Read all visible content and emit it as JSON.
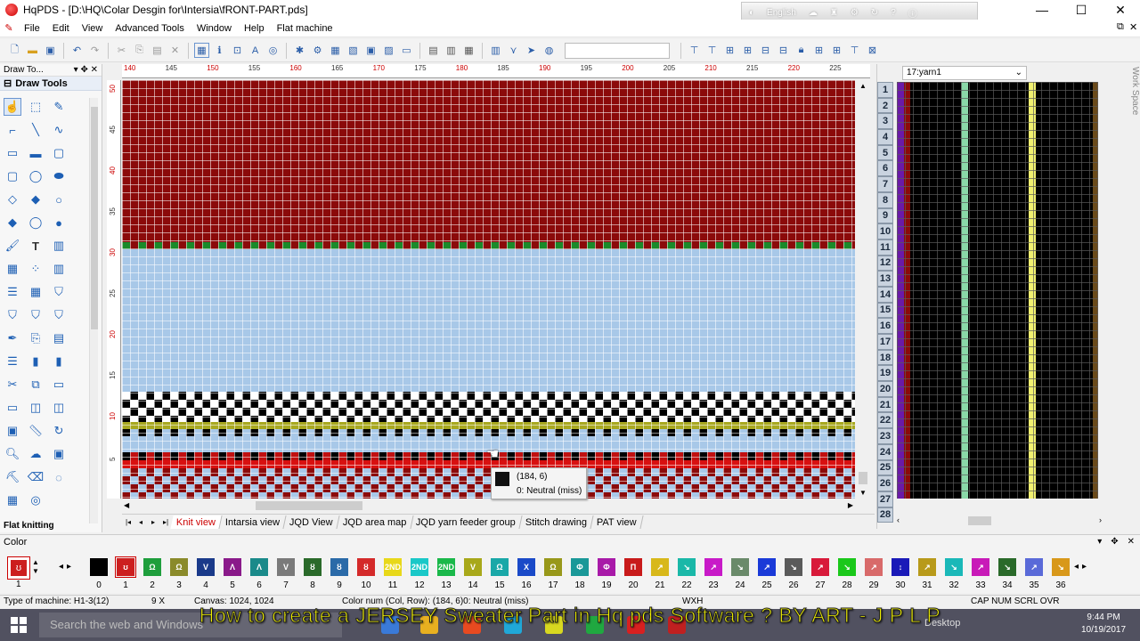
{
  "window": {
    "title": "HqPDS - [D:\\HQ\\Colar Desgin for\\Intersia\\fRONT-PART.pds]",
    "language": "English",
    "minimize": "—",
    "maximize": "☐",
    "close": "✕"
  },
  "menu": [
    "File",
    "Edit",
    "View",
    "Advanced Tools",
    "Window",
    "Help",
    "Flat machine"
  ],
  "left_panel": {
    "dock_title": "Draw To...",
    "section": "Draw Tools",
    "footer": "Flat knitting"
  },
  "rulers": {
    "top": [
      "140",
      "145",
      "150",
      "155",
      "160",
      "165",
      "170",
      "175",
      "180",
      "185",
      "190",
      "195",
      "200",
      "205",
      "210",
      "215",
      "220",
      "225"
    ],
    "left": [
      "50",
      "45",
      "40",
      "35",
      "30",
      "25",
      "20",
      "15",
      "10",
      "5"
    ]
  },
  "tooltip": {
    "coord": "(184, 6)",
    "info": "0: Neutral (miss)"
  },
  "tabs": [
    {
      "label": "Knit view",
      "active": true
    },
    {
      "label": "Intarsia view"
    },
    {
      "label": "JQD View"
    },
    {
      "label": "JQD area map"
    },
    {
      "label": "JQD yarn feeder group"
    },
    {
      "label": "Stitch drawing"
    },
    {
      "label": "PAT view"
    }
  ],
  "right_panel": {
    "selector": "17:yarn1",
    "rows": [
      "1",
      "2",
      "3",
      "4",
      "5",
      "6",
      "7",
      "8",
      "9",
      "10",
      "11",
      "12",
      "13",
      "14",
      "15",
      "16",
      "17",
      "18",
      "19",
      "20",
      "21",
      "22",
      "23",
      "24",
      "25",
      "26",
      "27",
      "28"
    ],
    "side_tab": "Work Space"
  },
  "color_panel": {
    "title": "Color",
    "current_index": "1",
    "swatches": [
      {
        "num": "0",
        "color": "#000000",
        "label": ""
      },
      {
        "num": "1",
        "color": "#cc1f1f",
        "label": "ʊ"
      },
      {
        "num": "2",
        "color": "#1e9e3c",
        "label": "Ω"
      },
      {
        "num": "3",
        "color": "#8a8a2a",
        "label": "Ω"
      },
      {
        "num": "4",
        "color": "#1a3a8a",
        "label": "V"
      },
      {
        "num": "5",
        "color": "#8a1a8a",
        "label": "Λ"
      },
      {
        "num": "6",
        "color": "#1a8a8a",
        "label": "Λ"
      },
      {
        "num": "7",
        "color": "#7a7a7a",
        "label": "V"
      },
      {
        "num": "8",
        "color": "#2a6a2a",
        "label": "ȣ"
      },
      {
        "num": "9",
        "color": "#2a6aa8",
        "label": "ȣ"
      },
      {
        "num": "10",
        "color": "#d42a2a",
        "label": "ȣ"
      },
      {
        "num": "11",
        "color": "#e8d81a",
        "label": "2ND"
      },
      {
        "num": "12",
        "color": "#1ac8c8",
        "label": "2ND"
      },
      {
        "num": "13",
        "color": "#1ab84a",
        "label": "2ND"
      },
      {
        "num": "14",
        "color": "#a8a81a",
        "label": "V"
      },
      {
        "num": "15",
        "color": "#1aa8a8",
        "label": "Ω"
      },
      {
        "num": "16",
        "color": "#1a4ac8",
        "label": "X"
      },
      {
        "num": "17",
        "color": "#98981a",
        "label": "Ω"
      },
      {
        "num": "18",
        "color": "#1a9898",
        "label": "Φ"
      },
      {
        "num": "19",
        "color": "#a81aa8",
        "label": "Φ"
      },
      {
        "num": "20",
        "color": "#c81a1a",
        "label": "Π"
      },
      {
        "num": "21",
        "color": "#d8b81a",
        "label": "↗"
      },
      {
        "num": "22",
        "color": "#1ab8a8",
        "label": "↘"
      },
      {
        "num": "23",
        "color": "#c81ac8",
        "label": "↗"
      },
      {
        "num": "24",
        "color": "#6a8a6a",
        "label": "↘"
      },
      {
        "num": "25",
        "color": "#1a3ad8",
        "label": "↗"
      },
      {
        "num": "26",
        "color": "#5a5a5a",
        "label": "↘"
      },
      {
        "num": "27",
        "color": "#d81a3a",
        "label": "↗"
      },
      {
        "num": "28",
        "color": "#1ac81a",
        "label": "↘"
      },
      {
        "num": "29",
        "color": "#d86a6a",
        "label": "↗"
      },
      {
        "num": "30",
        "color": "#1a1ab8",
        "label": "↕"
      },
      {
        "num": "31",
        "color": "#b89a1a",
        "label": "↗"
      },
      {
        "num": "32",
        "color": "#1ab8b8",
        "label": "↘"
      },
      {
        "num": "33",
        "color": "#c81ab8",
        "label": "↗"
      },
      {
        "num": "34",
        "color": "#2a6a2a",
        "label": "↘"
      },
      {
        "num": "35",
        "color": "#5a6ad8",
        "label": "↗"
      },
      {
        "num": "36",
        "color": "#d8981a",
        "label": "↘"
      }
    ]
  },
  "status": {
    "machine": "Type of machine: H1-3(12)",
    "zoom": "9 X",
    "canvas": "Canvas: 1024, 1024",
    "color_num": "Color num  (Col, Row): (184, 6)0: Neutral (miss)",
    "wxh": "WXH",
    "caps": "CAP  NUM  SCRL  OVR"
  },
  "caption": "How to create a JERSEY Sweater Part in Hq pds Software ? BY ART  - J P L P",
  "taskbar": {
    "search": "Search the web and Windows",
    "desktop": "Desktop",
    "time": "9:44 PM",
    "date": "10/19/2017"
  }
}
